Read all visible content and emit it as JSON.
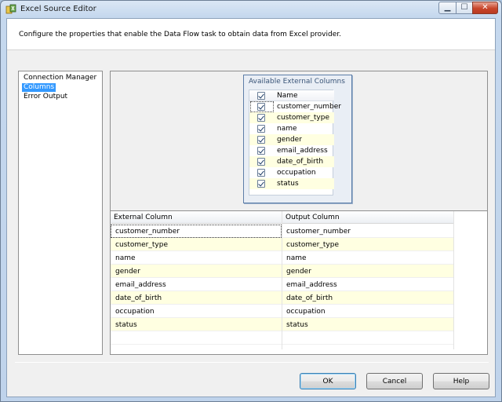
{
  "window": {
    "title": "Excel Source Editor"
  },
  "header": {
    "description": "Configure the properties that enable the Data Flow task to obtain data from Excel provider."
  },
  "nav": {
    "items": [
      {
        "label": "Connection Manager"
      },
      {
        "label": "Columns",
        "selected": true
      },
      {
        "label": "Error Output"
      }
    ]
  },
  "external_columns_box": {
    "title": "Available External Columns",
    "header": "Name",
    "columns": [
      {
        "name": "customer_number",
        "checked": true
      },
      {
        "name": "customer_type",
        "checked": true
      },
      {
        "name": "name",
        "checked": true
      },
      {
        "name": "gender",
        "checked": true
      },
      {
        "name": "email_address",
        "checked": true
      },
      {
        "name": "date_of_birth",
        "checked": true
      },
      {
        "name": "occupation",
        "checked": true
      },
      {
        "name": "status",
        "checked": true
      }
    ]
  },
  "mapping_grid": {
    "headers": [
      "External Column",
      "Output Column"
    ],
    "rows": [
      [
        "customer_number",
        "customer_number"
      ],
      [
        "customer_type",
        "customer_type"
      ],
      [
        "name",
        "name"
      ],
      [
        "gender",
        "gender"
      ],
      [
        "email_address",
        "email_address"
      ],
      [
        "date_of_birth",
        "date_of_birth"
      ],
      [
        "occupation",
        "occupation"
      ],
      [
        "status",
        "status"
      ]
    ]
  },
  "buttons": {
    "ok": "OK",
    "cancel": "Cancel",
    "help": "Help"
  },
  "colors": {
    "selection": "#3399ff",
    "alt_row": "#ffffe1",
    "box_border": "#5d7ea8"
  },
  "icons": {
    "app": "excel-source-icon",
    "minimize": "minimize-icon",
    "maximize": "maximize-icon",
    "close": "close-icon"
  }
}
